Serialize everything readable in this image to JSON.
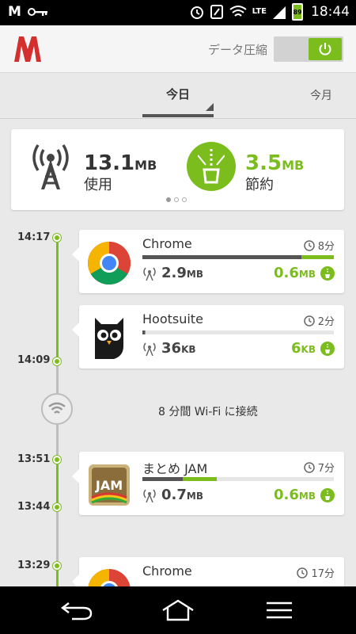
{
  "status_bar": {
    "time": "18:44",
    "network": "LTE",
    "battery": "89"
  },
  "app_bar": {
    "compress_label": "データ圧縮",
    "compress_on": true
  },
  "tabs": {
    "today": "今日",
    "month": "今月"
  },
  "summary": {
    "used_value": "13.1",
    "used_unit": "MB",
    "used_label": "使用",
    "saved_value": "3.5",
    "saved_unit": "MB",
    "saved_label": "節約"
  },
  "wifi_notice": "8 分間 Wi-Fi に接続",
  "timeline": {
    "t1": "14:17",
    "t2": "14:09",
    "t3": "13:51",
    "t4": "13:44",
    "t5": "13:29"
  },
  "cards": [
    {
      "name": "Chrome",
      "duration": "8分",
      "used_value": "2.9",
      "used_unit": "MB",
      "saved_value": "0.6",
      "saved_unit": "MB",
      "used_fraction": 0.83,
      "saved_fraction": 0.17
    },
    {
      "name": "Hootsuite",
      "duration": "2分",
      "used_value": "36",
      "used_unit": "KB",
      "saved_value": "6",
      "saved_unit": "KB",
      "used_fraction": 0.012,
      "saved_fraction": 0.003
    },
    {
      "name": "まとめ JAM",
      "duration": "7分",
      "used_value": "0.7",
      "used_unit": "MB",
      "saved_value": "0.6",
      "saved_unit": "MB",
      "used_fraction": 0.21,
      "saved_fraction": 0.18
    },
    {
      "name": "Chrome",
      "duration": "17分"
    }
  ],
  "colors": {
    "accent_green": "#7cbd1e",
    "opera_red": "#d32f2f"
  }
}
